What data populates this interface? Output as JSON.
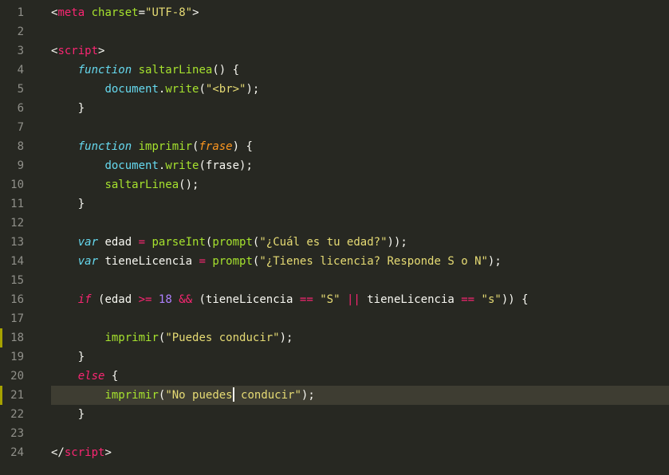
{
  "editor": {
    "active_line": 21,
    "modified_lines": [
      18,
      21
    ],
    "lines": [
      {
        "n": 1,
        "tokens": [
          [
            "punct",
            "<"
          ],
          [
            "tag",
            "meta"
          ],
          [
            "ident",
            " "
          ],
          [
            "attr-name",
            "charset"
          ],
          [
            "punct",
            "="
          ],
          [
            "attr-val",
            "\"UTF-8\""
          ],
          [
            "punct",
            ">"
          ]
        ]
      },
      {
        "n": 2,
        "tokens": []
      },
      {
        "n": 3,
        "tokens": [
          [
            "punct",
            "<"
          ],
          [
            "tag",
            "script"
          ],
          [
            "punct",
            ">"
          ]
        ]
      },
      {
        "n": 4,
        "tokens": [
          [
            "ident",
            "    "
          ],
          [
            "storage",
            "function"
          ],
          [
            "ident",
            " "
          ],
          [
            "func-name",
            "saltarLinea"
          ],
          [
            "punct",
            "() {"
          ]
        ]
      },
      {
        "n": 5,
        "tokens": [
          [
            "ident",
            "        "
          ],
          [
            "builtin",
            "document"
          ],
          [
            "punct",
            "."
          ],
          [
            "func-name",
            "write"
          ],
          [
            "punct",
            "("
          ],
          [
            "string",
            "\"<br>\""
          ],
          [
            "punct",
            ");"
          ]
        ]
      },
      {
        "n": 6,
        "tokens": [
          [
            "ident",
            "    "
          ],
          [
            "punct",
            "}"
          ]
        ]
      },
      {
        "n": 7,
        "tokens": []
      },
      {
        "n": 8,
        "tokens": [
          [
            "ident",
            "    "
          ],
          [
            "storage",
            "function"
          ],
          [
            "ident",
            " "
          ],
          [
            "func-name",
            "imprimir"
          ],
          [
            "punct",
            "("
          ],
          [
            "param",
            "frase"
          ],
          [
            "punct",
            ") {"
          ]
        ]
      },
      {
        "n": 9,
        "tokens": [
          [
            "ident",
            "        "
          ],
          [
            "builtin",
            "document"
          ],
          [
            "punct",
            "."
          ],
          [
            "func-name",
            "write"
          ],
          [
            "punct",
            "(frase);"
          ]
        ]
      },
      {
        "n": 10,
        "tokens": [
          [
            "ident",
            "        "
          ],
          [
            "func-name",
            "saltarLinea"
          ],
          [
            "punct",
            "();"
          ]
        ]
      },
      {
        "n": 11,
        "tokens": [
          [
            "ident",
            "    "
          ],
          [
            "punct",
            "}"
          ]
        ]
      },
      {
        "n": 12,
        "tokens": []
      },
      {
        "n": 13,
        "tokens": [
          [
            "ident",
            "    "
          ],
          [
            "storage",
            "var"
          ],
          [
            "ident",
            " edad "
          ],
          [
            "operator",
            "="
          ],
          [
            "ident",
            " "
          ],
          [
            "func-name",
            "parseInt"
          ],
          [
            "punct",
            "("
          ],
          [
            "func-name",
            "prompt"
          ],
          [
            "punct",
            "("
          ],
          [
            "string",
            "\"¿Cuál es tu edad?\""
          ],
          [
            "punct",
            "));"
          ]
        ]
      },
      {
        "n": 14,
        "tokens": [
          [
            "ident",
            "    "
          ],
          [
            "storage",
            "var"
          ],
          [
            "ident",
            " tieneLicencia "
          ],
          [
            "operator",
            "="
          ],
          [
            "ident",
            " "
          ],
          [
            "func-name",
            "prompt"
          ],
          [
            "punct",
            "("
          ],
          [
            "string",
            "\"¿Tienes licencia? Responde S o N\""
          ],
          [
            "punct",
            ");"
          ]
        ]
      },
      {
        "n": 15,
        "tokens": []
      },
      {
        "n": 16,
        "tokens": [
          [
            "ident",
            "    "
          ],
          [
            "keyword",
            "if"
          ],
          [
            "ident",
            " "
          ],
          [
            "punct",
            "(edad "
          ],
          [
            "operator",
            ">="
          ],
          [
            "ident",
            " "
          ],
          [
            "number",
            "18"
          ],
          [
            "ident",
            " "
          ],
          [
            "operator",
            "&&"
          ],
          [
            "ident",
            " "
          ],
          [
            "punct",
            "(tieneLicencia "
          ],
          [
            "operator",
            "=="
          ],
          [
            "ident",
            " "
          ],
          [
            "string",
            "\"S\""
          ],
          [
            "ident",
            " "
          ],
          [
            "operator",
            "||"
          ],
          [
            "ident",
            " tieneLicencia "
          ],
          [
            "operator",
            "=="
          ],
          [
            "ident",
            " "
          ],
          [
            "string",
            "\"s\""
          ],
          [
            "punct",
            ")) {"
          ]
        ]
      },
      {
        "n": 17,
        "tokens": []
      },
      {
        "n": 18,
        "tokens": [
          [
            "ident",
            "        "
          ],
          [
            "func-name",
            "imprimir"
          ],
          [
            "punct",
            "("
          ],
          [
            "string",
            "\"Puedes conducir\""
          ],
          [
            "punct",
            ");"
          ]
        ]
      },
      {
        "n": 19,
        "tokens": [
          [
            "ident",
            "    "
          ],
          [
            "punct",
            "}"
          ]
        ]
      },
      {
        "n": 20,
        "tokens": [
          [
            "ident",
            "    "
          ],
          [
            "keyword",
            "else"
          ],
          [
            "ident",
            " "
          ],
          [
            "punct",
            "{"
          ]
        ]
      },
      {
        "n": 21,
        "tokens": [
          [
            "ident",
            "        "
          ],
          [
            "func-name",
            "imprimir"
          ],
          [
            "punct",
            "("
          ],
          [
            "string",
            "\"No puedes"
          ],
          [
            "caret",
            ""
          ],
          [
            "string",
            " conducir\""
          ],
          [
            "punct",
            ");"
          ]
        ]
      },
      {
        "n": 22,
        "tokens": [
          [
            "ident",
            "    "
          ],
          [
            "punct",
            "}"
          ]
        ]
      },
      {
        "n": 23,
        "tokens": []
      },
      {
        "n": 24,
        "tokens": [
          [
            "punct",
            "</"
          ],
          [
            "tag",
            "script"
          ],
          [
            "punct",
            ">"
          ]
        ]
      }
    ]
  }
}
